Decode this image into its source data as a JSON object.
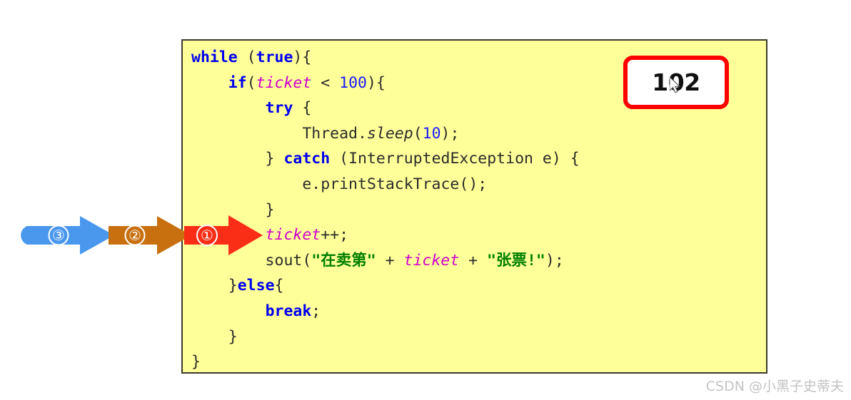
{
  "code_panel": {
    "background_color": "#ffff99",
    "border_color": "#3a3a2e",
    "language": "java",
    "lines": [
      [
        {
          "t": "while",
          "c": "kw"
        },
        {
          "t": " (",
          "c": "pl"
        },
        {
          "t": "true",
          "c": "kw"
        },
        {
          "t": "){",
          "c": "pl"
        }
      ],
      [
        {
          "t": "    ",
          "c": "pl"
        },
        {
          "t": "if",
          "c": "kw"
        },
        {
          "t": "(",
          "c": "pl"
        },
        {
          "t": "ticket",
          "c": "fld"
        },
        {
          "t": " < ",
          "c": "pl"
        },
        {
          "t": "100",
          "c": "num"
        },
        {
          "t": "){",
          "c": "pl"
        }
      ],
      [
        {
          "t": "        ",
          "c": "pl"
        },
        {
          "t": "try",
          "c": "kw"
        },
        {
          "t": " {",
          "c": "pl"
        }
      ],
      [
        {
          "t": "            Thread.",
          "c": "pl"
        },
        {
          "t": "sleep",
          "c": "mth"
        },
        {
          "t": "(",
          "c": "pl"
        },
        {
          "t": "10",
          "c": "num"
        },
        {
          "t": ");",
          "c": "pl"
        }
      ],
      [
        {
          "t": "        } ",
          "c": "pl"
        },
        {
          "t": "catch",
          "c": "kw"
        },
        {
          "t": " (InterruptedException e) {",
          "c": "pl"
        }
      ],
      [
        {
          "t": "            e.printStackTrace();",
          "c": "pl"
        }
      ],
      [
        {
          "t": "        }",
          "c": "pl"
        }
      ],
      [
        {
          "t": "        ",
          "c": "pl"
        },
        {
          "t": "ticket",
          "c": "fld"
        },
        {
          "t": "++;",
          "c": "pl"
        }
      ],
      [
        {
          "t": "        sout(",
          "c": "pl"
        },
        {
          "t": "\"在卖第\"",
          "c": "str"
        },
        {
          "t": " + ",
          "c": "pl"
        },
        {
          "t": "ticket",
          "c": "fld"
        },
        {
          "t": " + ",
          "c": "pl"
        },
        {
          "t": "\"张票!\"",
          "c": "str"
        },
        {
          "t": ");",
          "c": "pl"
        }
      ],
      [
        {
          "t": "    }",
          "c": "pl"
        },
        {
          "t": "else",
          "c": "kw"
        },
        {
          "t": "{",
          "c": "pl"
        }
      ],
      [
        {
          "t": "        ",
          "c": "pl"
        },
        {
          "t": "break",
          "c": "kw"
        },
        {
          "t": ";",
          "c": "pl"
        }
      ],
      [
        {
          "t": "    }",
          "c": "pl"
        }
      ],
      [
        {
          "t": "}",
          "c": "pl"
        }
      ]
    ]
  },
  "value_badge": {
    "value": "102",
    "border_color": "#ff0000",
    "fill_color": "#ffffff"
  },
  "arrows": [
    {
      "id": "3",
      "label": "③",
      "color": "#4a97ee"
    },
    {
      "id": "2",
      "label": "②",
      "color": "#c8700f"
    },
    {
      "id": "1",
      "label": "①",
      "color": "#fa2d16"
    }
  ],
  "watermark": {
    "text": "CSDN @小黑子史蒂夫",
    "color": "#c3c3c3"
  }
}
